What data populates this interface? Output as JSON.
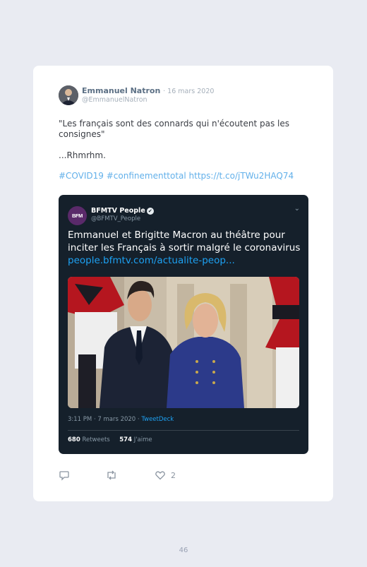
{
  "tweet": {
    "author_name": "Emmanuel Natron",
    "date": "· 16 mars 2020",
    "handle": "@EmmanuelNatron",
    "text_1": "\"Les français sont des connards qui n'écoutent pas les consignes\"",
    "text_2": "...Rhmrhm.",
    "hashtags_link": "#COVID19 #confinementtotal https://t.co/jTWu2HAQ74",
    "reply_count": "",
    "retweet_count": "",
    "like_count": "2"
  },
  "embed": {
    "logo_text": "BFM",
    "author_name": "BFMTV People",
    "handle": "@BFMTV_People",
    "text": "Emmanuel et Brigitte Macron au théâtre pour inciter les Français à sortir malgré le coronavirus",
    "link": "people.bfmtv.com/actualite-peop...",
    "meta_time": "3:11 PM · 7 mars 2020 · ",
    "meta_source": "TweetDeck",
    "retweets_value": "680",
    "retweets_label": "Retweets",
    "likes_value": "574",
    "likes_label": "J'aime"
  },
  "icons": {
    "reply": "reply-icon",
    "retweet": "retweet-icon",
    "like": "heart-icon",
    "menu": "chevron-down-icon",
    "verified": "verified-badge-icon"
  },
  "colors": {
    "link": "#62b0ea",
    "embed_bg": "#15202b",
    "accent": "#1da1f2",
    "page_bg": "#e9ebf2"
  },
  "page": {
    "number": "46"
  }
}
